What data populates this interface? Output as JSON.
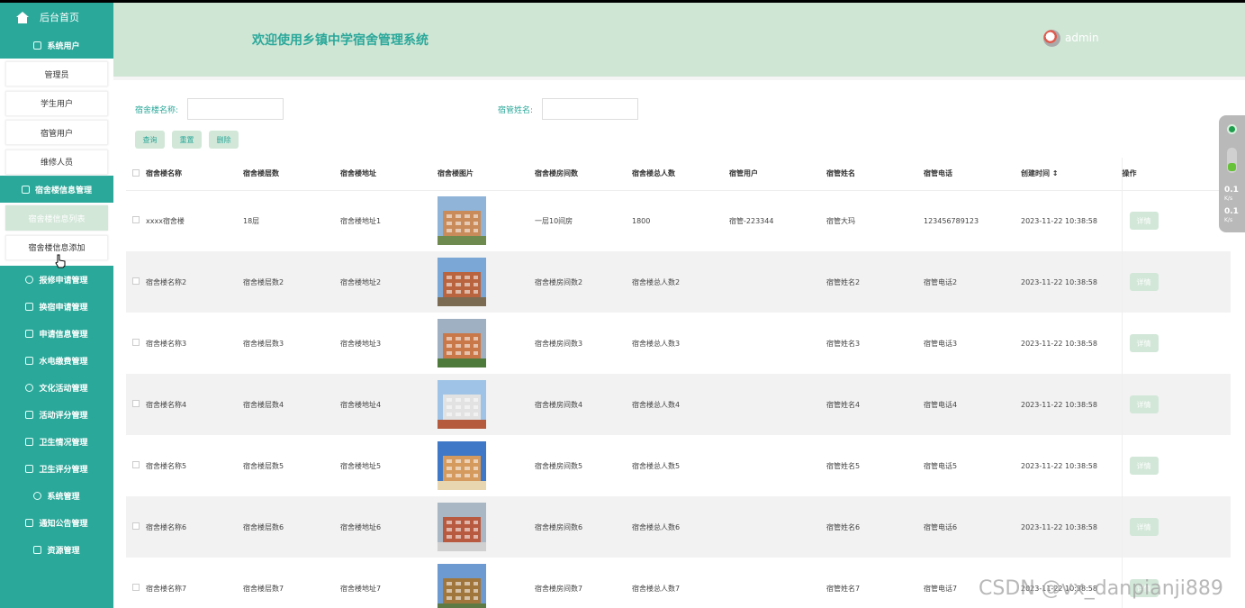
{
  "sidebar": {
    "home": "后台首页",
    "groups": {
      "users": "系统用户",
      "building": "宿舍楼信息管理",
      "g1": "报修申请管理",
      "g2": "换宿申请管理",
      "g3": "申请信息管理",
      "g4": "水电缴费管理",
      "g5": "文化活动管理",
      "g6": "活动评分管理",
      "g7": "卫生情况管理",
      "g8": "卫生评分管理",
      "g9": "系统管理",
      "g10": "通知公告管理",
      "g11": "资源管理"
    },
    "users_sub": [
      "管理员",
      "学生用户",
      "宿管用户",
      "维修人员"
    ],
    "building_sub": [
      "宿舍楼信息列表",
      "宿舍楼信息添加"
    ]
  },
  "header": {
    "title": "欢迎使用乡镇中学宿舍管理系统",
    "user": "admin"
  },
  "filters": {
    "building_name_label": "宿舍楼名称:",
    "manager_name_label": "宿管姓名:",
    "search": "查询",
    "reset": "重置",
    "delete": "删除"
  },
  "table": {
    "headers": [
      "宿舍楼名称",
      "宿舍楼层数",
      "宿舍楼地址",
      "宿舍楼图片",
      "宿舍楼房间数",
      "宿舍楼总人数",
      "宿管用户",
      "宿管姓名",
      "宿管电话",
      "创建时间 ↕",
      "操作"
    ],
    "detail": "详情",
    "rows": [
      [
        "xxxx宿舍楼",
        "18层",
        "宿舍楼地址1",
        "一层10间房",
        "1800",
        "宿管-223344",
        "宿管大玛",
        "123456789123",
        "2023-11-22 10:38:58"
      ],
      [
        "宿舍楼名称2",
        "宿舍楼层数2",
        "宿舍楼地址2",
        "宿舍楼房间数2",
        "宿舍楼总人数2",
        "",
        "宿管姓名2",
        "宿管电话2",
        "2023-11-22 10:38:58"
      ],
      [
        "宿舍楼名称3",
        "宿舍楼层数3",
        "宿舍楼地址3",
        "宿舍楼房间数3",
        "宿舍楼总人数3",
        "",
        "宿管姓名3",
        "宿管电话3",
        "2023-11-22 10:38:58"
      ],
      [
        "宿舍楼名称4",
        "宿舍楼层数4",
        "宿舍楼地址4",
        "宿舍楼房间数4",
        "宿舍楼总人数4",
        "",
        "宿管姓名4",
        "宿管电话4",
        "2023-11-22 10:38:58"
      ],
      [
        "宿舍楼名称5",
        "宿舍楼层数5",
        "宿舍楼地址5",
        "宿舍楼房间数5",
        "宿舍楼总人数5",
        "",
        "宿管姓名5",
        "宿管电话5",
        "2023-11-22 10:38:58"
      ],
      [
        "宿舍楼名称6",
        "宿舍楼层数6",
        "宿舍楼地址6",
        "宿舍楼房间数6",
        "宿舍楼总人数6",
        "",
        "宿管姓名6",
        "宿管电话6",
        "2023-11-22 10:38:58"
      ],
      [
        "宿舍楼名称7",
        "宿舍楼层数7",
        "宿舍楼地址7",
        "宿舍楼房间数7",
        "宿舍楼总人数7",
        "",
        "宿管姓名7",
        "宿管电话7",
        "2023-11-22 10:38:58"
      ]
    ]
  },
  "widget": {
    "speed_up": "0.1",
    "speed_down": "0.1",
    "unit": "K/s"
  },
  "watermark": "CSDN @vx_danpianji889",
  "colors": {
    "primary": "#2aa89a",
    "header_bg": "#d0e6d5",
    "button_bg": "#d2e7d8"
  }
}
